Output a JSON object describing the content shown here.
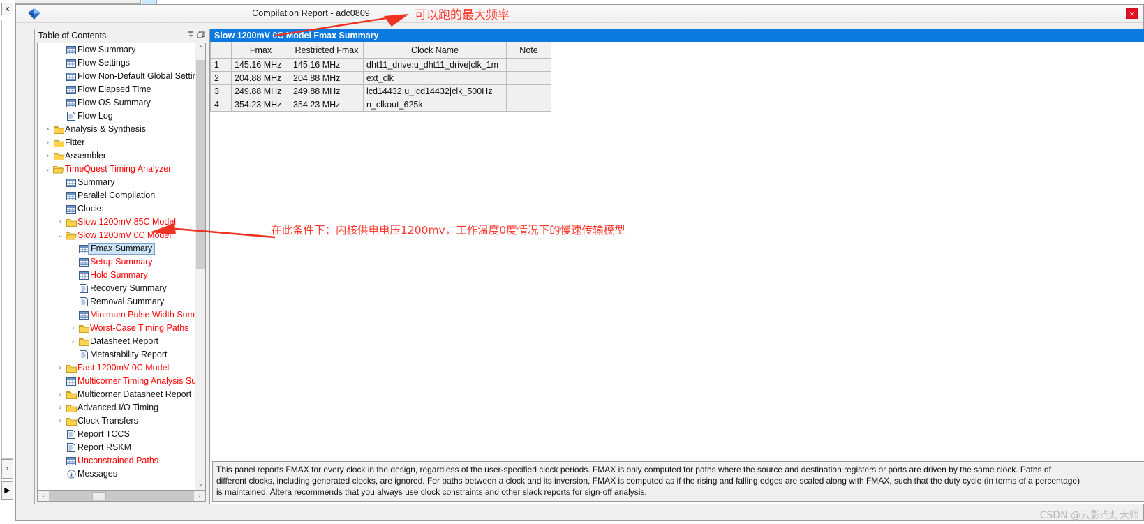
{
  "window": {
    "title": "Compilation Report - adc0809",
    "close_label": "close-button",
    "icon": "quartus-diamond-icon"
  },
  "gutter": {
    "close_label": "x",
    "expand_right_label": "›",
    "play_label": "▶"
  },
  "toc": {
    "header": "Table of Contents",
    "pin_icon": "pin-icon",
    "float_icon": "restore-icon",
    "scroll_up": "⌃",
    "scroll_down": "⌄",
    "scroll_left": "‹",
    "scroll_right": "›",
    "items": [
      {
        "label": "Flow Summary",
        "indent": 1,
        "icon": "table-icon",
        "twisty": "",
        "red": false,
        "selected": false
      },
      {
        "label": "Flow Settings",
        "indent": 1,
        "icon": "table-icon",
        "twisty": "",
        "red": false,
        "selected": false
      },
      {
        "label": "Flow Non-Default Global Settings",
        "indent": 1,
        "icon": "table-icon",
        "twisty": "",
        "red": false,
        "selected": false
      },
      {
        "label": "Flow Elapsed Time",
        "indent": 1,
        "icon": "table-icon",
        "twisty": "",
        "red": false,
        "selected": false
      },
      {
        "label": "Flow OS Summary",
        "indent": 1,
        "icon": "table-icon",
        "twisty": "",
        "red": false,
        "selected": false
      },
      {
        "label": "Flow Log",
        "indent": 1,
        "icon": "document-icon",
        "twisty": "",
        "red": false,
        "selected": false
      },
      {
        "label": "Analysis & Synthesis",
        "indent": 0,
        "icon": "folder-icon",
        "twisty": "›",
        "red": false,
        "selected": false
      },
      {
        "label": "Fitter",
        "indent": 0,
        "icon": "folder-icon",
        "twisty": "›",
        "red": false,
        "selected": false
      },
      {
        "label": "Assembler",
        "indent": 0,
        "icon": "folder-icon",
        "twisty": "›",
        "red": false,
        "selected": false
      },
      {
        "label": "TimeQuest Timing Analyzer",
        "indent": 0,
        "icon": "folder-open-icon",
        "twisty": "⌄",
        "red": true,
        "selected": false
      },
      {
        "label": "Summary",
        "indent": 1,
        "icon": "table-icon",
        "twisty": "",
        "red": false,
        "selected": false
      },
      {
        "label": "Parallel Compilation",
        "indent": 1,
        "icon": "table-icon",
        "twisty": "",
        "red": false,
        "selected": false
      },
      {
        "label": "Clocks",
        "indent": 1,
        "icon": "table-icon",
        "twisty": "",
        "red": false,
        "selected": false
      },
      {
        "label": "Slow 1200mV 85C Model",
        "indent": 1,
        "icon": "folder-icon",
        "twisty": "›",
        "red": true,
        "selected": false
      },
      {
        "label": "Slow 1200mV 0C Model",
        "indent": 1,
        "icon": "folder-open-icon",
        "twisty": "⌄",
        "red": true,
        "selected": false
      },
      {
        "label": "Fmax Summary",
        "indent": 2,
        "icon": "table-icon",
        "twisty": "",
        "red": false,
        "selected": true
      },
      {
        "label": "Setup Summary",
        "indent": 2,
        "icon": "table-icon",
        "twisty": "",
        "red": true,
        "selected": false
      },
      {
        "label": "Hold Summary",
        "indent": 2,
        "icon": "table-icon",
        "twisty": "",
        "red": true,
        "selected": false
      },
      {
        "label": "Recovery Summary",
        "indent": 2,
        "icon": "document-icon",
        "twisty": "",
        "red": false,
        "selected": false
      },
      {
        "label": "Removal Summary",
        "indent": 2,
        "icon": "document-icon",
        "twisty": "",
        "red": false,
        "selected": false
      },
      {
        "label": "Minimum Pulse Width Sum",
        "indent": 2,
        "icon": "table-icon",
        "twisty": "",
        "red": true,
        "selected": false
      },
      {
        "label": "Worst-Case Timing Paths",
        "indent": 2,
        "icon": "folder-icon",
        "twisty": "›",
        "red": true,
        "selected": false
      },
      {
        "label": "Datasheet Report",
        "indent": 2,
        "icon": "folder-icon",
        "twisty": "›",
        "red": false,
        "selected": false
      },
      {
        "label": "Metastability Report",
        "indent": 2,
        "icon": "document-icon",
        "twisty": "",
        "red": false,
        "selected": false
      },
      {
        "label": "Fast 1200mV 0C Model",
        "indent": 1,
        "icon": "folder-icon",
        "twisty": "›",
        "red": true,
        "selected": false
      },
      {
        "label": "Multicorner Timing Analysis Su",
        "indent": 1,
        "icon": "table-icon",
        "twisty": "",
        "red": true,
        "selected": false
      },
      {
        "label": "Multicorner Datasheet Report :",
        "indent": 1,
        "icon": "folder-icon",
        "twisty": "›",
        "red": false,
        "selected": false
      },
      {
        "label": "Advanced I/O Timing",
        "indent": 1,
        "icon": "folder-icon",
        "twisty": "›",
        "red": false,
        "selected": false
      },
      {
        "label": "Clock Transfers",
        "indent": 1,
        "icon": "folder-icon",
        "twisty": "›",
        "red": false,
        "selected": false
      },
      {
        "label": "Report TCCS",
        "indent": 1,
        "icon": "document-icon",
        "twisty": "",
        "red": false,
        "selected": false
      },
      {
        "label": "Report RSKM",
        "indent": 1,
        "icon": "document-icon",
        "twisty": "",
        "red": false,
        "selected": false
      },
      {
        "label": "Unconstrained Paths",
        "indent": 1,
        "icon": "table-icon",
        "twisty": "",
        "red": true,
        "selected": false
      },
      {
        "label": "Messages",
        "indent": 1,
        "icon": "info-icon",
        "twisty": "",
        "red": false,
        "selected": false
      }
    ]
  },
  "report": {
    "panel_title": "Slow 1200mV 0C Model Fmax Summary",
    "columns": [
      "",
      "Fmax",
      "Restricted Fmax",
      "Clock Name",
      "Note"
    ],
    "rows": [
      {
        "n": "1",
        "fmax": "145.16 MHz",
        "restricted": "145.16 MHz",
        "clock": "dht11_drive:u_dht11_drive|clk_1m",
        "note": ""
      },
      {
        "n": "2",
        "fmax": "204.88 MHz",
        "restricted": "204.88 MHz",
        "clock": "ext_clk",
        "note": ""
      },
      {
        "n": "3",
        "fmax": "249.88 MHz",
        "restricted": "249.88 MHz",
        "clock": "lcd14432:u_lcd14432|clk_500Hz",
        "note": ""
      },
      {
        "n": "4",
        "fmax": "354.23 MHz",
        "restricted": "354.23 MHz",
        "clock": "n_clkout_625k",
        "note": ""
      }
    ],
    "description_lines": [
      "This panel reports FMAX for every clock in the design, regardless of the user-specified clock periods.  FMAX is only computed for paths where the source and destination registers or ports are driven by the same clock.  Paths of",
      "different clocks, including generated clocks, are ignored.  For paths between a clock and its inversion, FMAX is computed as if the rising and falling edges are scaled along with FMAX, such that the duty cycle (in terms of a percentage)",
      "is maintained. Altera recommends that you always use clock constraints and other slack reports for sign-off analysis."
    ]
  },
  "annotations": {
    "top_note": "可以跑的最大频率",
    "middle_note": "在此条件下：内核供电电压1200mv，工作温度0度情况下的慢速传输模型",
    "arrow_color": "#ee3322"
  },
  "watermark": "CSDN @云影点灯大师"
}
